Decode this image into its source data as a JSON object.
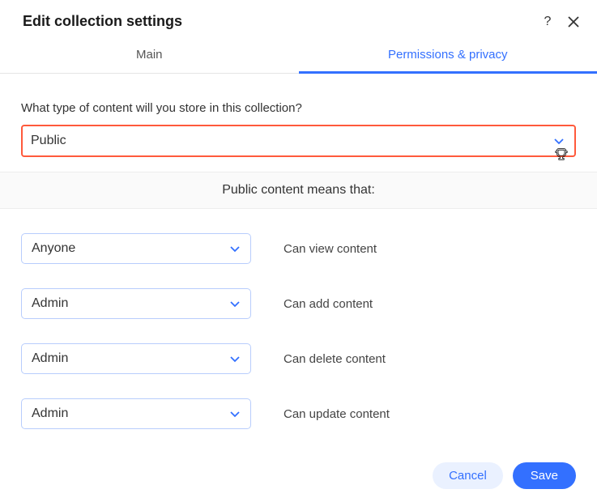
{
  "header": {
    "title": "Edit collection settings"
  },
  "tabs": {
    "main": "Main",
    "permissions": "Permissions & privacy"
  },
  "question": "What type of content will you store in this collection?",
  "content_type_value": "Public",
  "explain": "Public content means that:",
  "permissions": [
    {
      "role": "Anyone",
      "label": "Can view content"
    },
    {
      "role": "Admin",
      "label": "Can add content"
    },
    {
      "role": "Admin",
      "label": "Can delete content"
    },
    {
      "role": "Admin",
      "label": "Can update content"
    }
  ],
  "buttons": {
    "cancel": "Cancel",
    "save": "Save"
  }
}
